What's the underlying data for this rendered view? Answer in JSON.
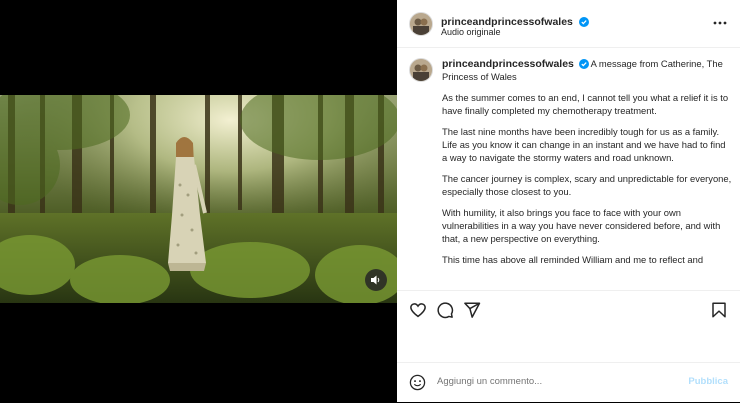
{
  "post": {
    "username": "princeandprincessofwales",
    "audio": "Audio originale",
    "more_icon": "more-horizontal-icon"
  },
  "caption": {
    "username": "princeandprincessofwales",
    "lead": "A message from Catherine, The Princess of Wales",
    "paragraphs": [
      "As the summer comes to an end, I cannot tell you what a relief it is to have finally completed my chemotherapy treatment.",
      "The last nine months have been incredibly tough for us as a family. Life as you know it can change in an instant and we have had to find a way to navigate the stormy waters and road unknown.",
      "The cancer journey is complex, scary and unpredictable for everyone, especially those closest to you.",
      "With humility, it also brings you face to face with your own vulnerabilities in a way you have never considered before, and with that, a new perspective on everything.",
      "This time has above all reminded William and me to reflect and"
    ]
  },
  "actions": {
    "like_icon": "heart-icon",
    "comment_icon": "comment-icon",
    "share_icon": "share-icon",
    "save_icon": "bookmark-icon"
  },
  "comment": {
    "placeholder": "Aggiungi un commento...",
    "publish_label": "Pubblica"
  },
  "colors": {
    "verified": "#0095f6",
    "publish_disabled": "#b2dffc"
  }
}
